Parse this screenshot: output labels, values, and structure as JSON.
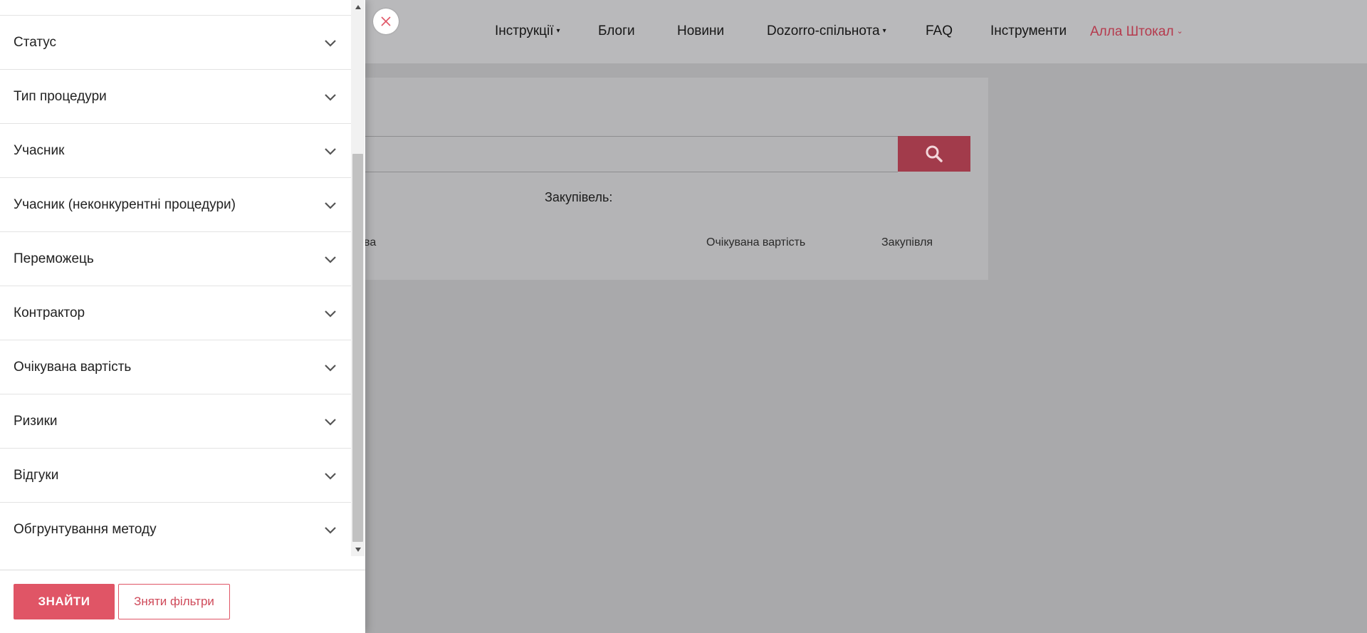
{
  "header": {
    "nav": [
      {
        "label": "Інструкції",
        "has_dropdown": true
      },
      {
        "label": "Блоги",
        "has_dropdown": false
      },
      {
        "label": "Новини",
        "has_dropdown": false
      },
      {
        "label": "Dozorro-спільнота",
        "has_dropdown": true
      },
      {
        "label": "FAQ",
        "has_dropdown": false
      },
      {
        "label": "Інструменти",
        "has_dropdown": false
      }
    ],
    "user": {
      "name": "Алла Штокал",
      "has_dropdown": true
    }
  },
  "main": {
    "search": {
      "button_icon": "search-icon"
    },
    "count_label": "Закупівель:",
    "table_headers": [
      "азва",
      "Очікувана вартість",
      "Закупівля"
    ]
  },
  "filter_panel": {
    "close_icon": "close-icon",
    "filters": [
      {
        "label": "Статус"
      },
      {
        "label": "Тип процедури"
      },
      {
        "label": "Учасник"
      },
      {
        "label": "Учасник (неконкурентні процедури)"
      },
      {
        "label": "Переможець"
      },
      {
        "label": "Контрактор"
      },
      {
        "label": "Очікувана вартість"
      },
      {
        "label": "Ризики"
      },
      {
        "label": "Відгуки"
      },
      {
        "label": "Обгрунтування методу"
      }
    ],
    "find_button": "ЗНАЙТИ",
    "clear_button": "Зняти фільтри"
  },
  "colors": {
    "accent": "#e05566",
    "search_button": "#a23b4b",
    "user_link": "#b53a4d",
    "overlay": "#a9a9ab"
  }
}
